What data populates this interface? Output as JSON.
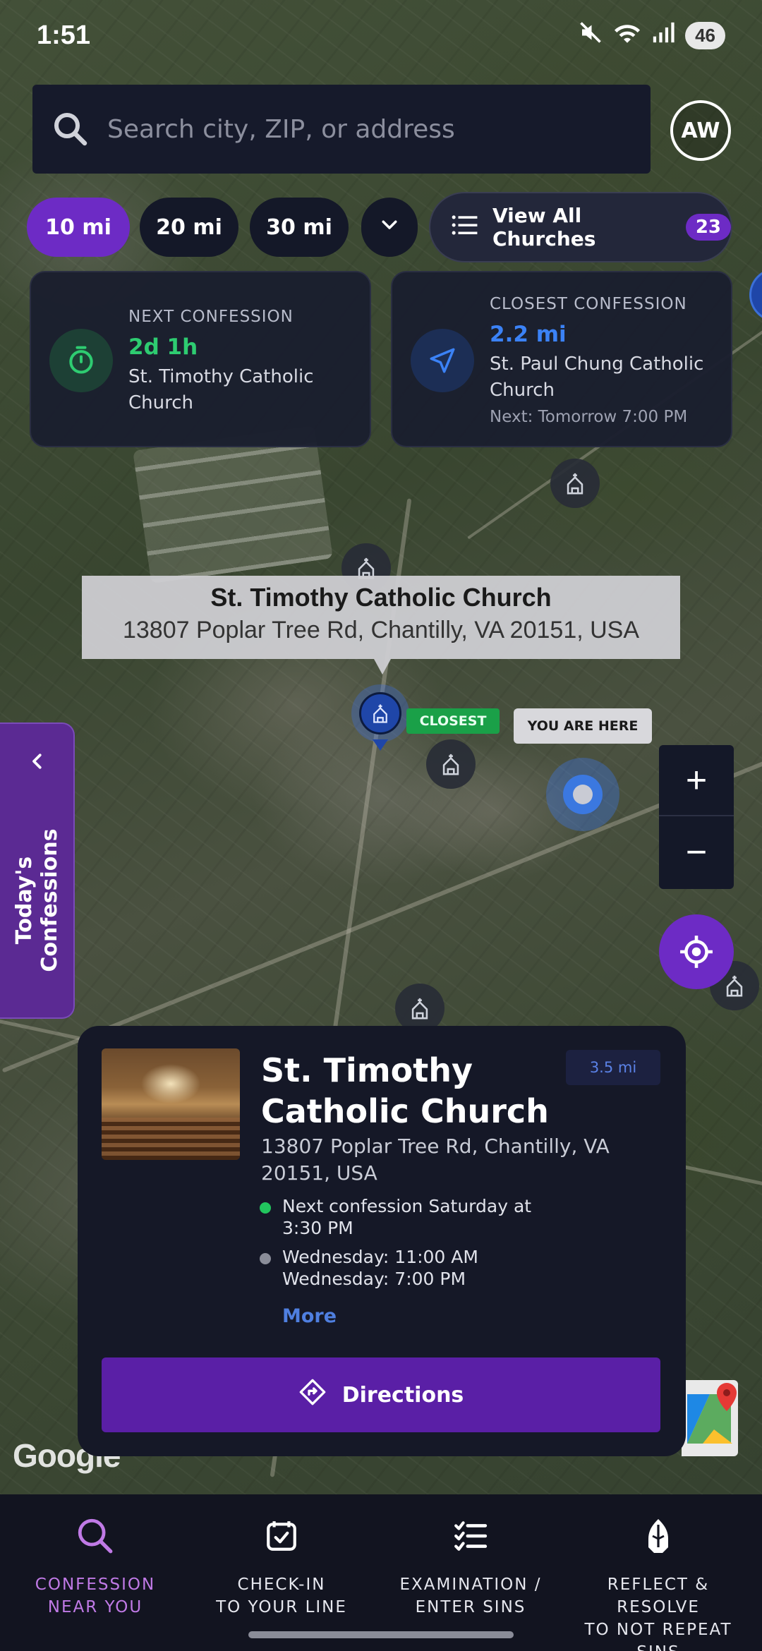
{
  "status_bar": {
    "time": "1:51",
    "battery": "46"
  },
  "search": {
    "placeholder": "Search city, ZIP, or address",
    "value": ""
  },
  "user": {
    "initials": "AW"
  },
  "radius_filters": {
    "options": [
      "10 mi",
      "20 mi",
      "30 mi"
    ],
    "selected": "10 mi"
  },
  "view_all": {
    "label": "View All Churches",
    "count": "23"
  },
  "next_confession": {
    "label": "NEXT CONFESSION",
    "value": "2d 1h",
    "church": "St. Timothy Catholic Church",
    "accent": "#2ecc71"
  },
  "closest_confession": {
    "label": "CLOSEST CONFESSION",
    "value": "2.2 mi",
    "church": "St. Paul Chung Catholic Church",
    "next": "Next: Tomorrow 7:00 PM",
    "accent": "#3b82f6"
  },
  "map": {
    "tooltip_title": "St. Timothy Catholic Church",
    "tooltip_address": "13807 Poplar Tree Rd, Chantilly, VA 20151, USA",
    "closest_tag": "CLOSEST",
    "you_are_here": "YOU ARE HERE",
    "zoom_in": "+",
    "zoom_out": "−",
    "google_logo": "Google"
  },
  "side_panel": {
    "label": "Today's Confessions"
  },
  "church_card": {
    "name": "St. Timothy Catholic Church",
    "distance": "3.5 mi",
    "address": "13807 Poplar Tree Rd, Chantilly, VA 20151, USA",
    "next_confession": "Next confession Saturday at 3:30 PM",
    "schedule_line1": "Wednesday: 11:00 AM",
    "schedule_line2": "Wednesday: 7:00 PM",
    "more_label": "More",
    "directions_label": "Directions"
  },
  "bottom_nav": {
    "items": [
      {
        "label": "CONFESSION\nNEAR YOU",
        "icon": "search-icon",
        "active": true
      },
      {
        "label": "CHECK-IN\nTO YOUR LINE",
        "icon": "check-square-icon",
        "active": false
      },
      {
        "label": "EXAMINATION /\nENTER SINS",
        "icon": "checklist-icon",
        "active": false
      },
      {
        "label": "REFLECT & RESOLVE\nTO NOT REPEAT SINS",
        "icon": "praying-hands-icon",
        "active": false
      }
    ]
  },
  "colors": {
    "accent_purple": "#6d2bc5",
    "panel_dark": "#151827",
    "active_nav": "#c07ae6",
    "link_blue": "#4f7fe0"
  }
}
